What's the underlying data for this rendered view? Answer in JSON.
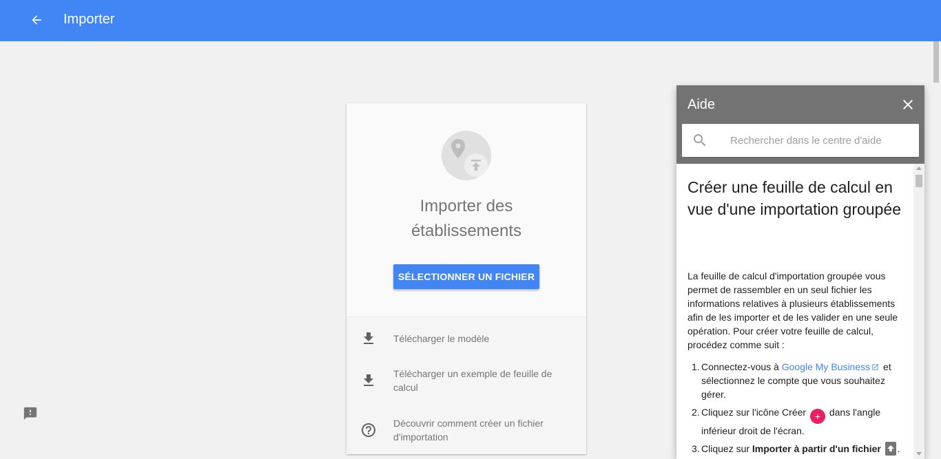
{
  "topbar": {
    "title": "Importer",
    "color": "#4285f4"
  },
  "card": {
    "title_line1": "Importer des",
    "title_line2": "établissements",
    "select_button": "SÉLECTIONNER UN FICHIER",
    "items": [
      {
        "icon": "download-icon",
        "label": "Télécharger le modèle"
      },
      {
        "icon": "download-icon",
        "label": "Télécharger un exemple de feuille de calcul"
      },
      {
        "icon": "help-circle-icon",
        "label": "Découvrir comment créer un fichier d'importation"
      }
    ]
  },
  "help": {
    "title": "Aide",
    "search_placeholder": "Rechercher dans le centre d'aide",
    "article_title": "Créer une feuille de calcul en vue d'une importation groupée",
    "intro": "La feuille de calcul d'importation groupée vous permet de rassembler en un seul fichier les informations relatives à plusieurs établissements afin de les importer et de les valider en une seule opération. Pour créer votre feuille de calcul, procédez comme suit :",
    "steps": [
      {
        "num": "1.",
        "before": "Connectez-vous à ",
        "link": "Google My Business",
        "after": " et sélectionnez le compte que vous souhaitez gérer."
      },
      {
        "num": "2.",
        "before": "Cliquez sur l'icône Créer ",
        "badge": "+",
        "after": " dans l'angle inférieur droit de l'écran."
      },
      {
        "num": "3.",
        "before": "Cliquez sur ",
        "bold": "Importer à partir d'un fichier",
        "after": "."
      }
    ]
  },
  "colors": {
    "accent": "#4285f4",
    "create_badge": "#e91e63",
    "help_header": "#737373"
  }
}
